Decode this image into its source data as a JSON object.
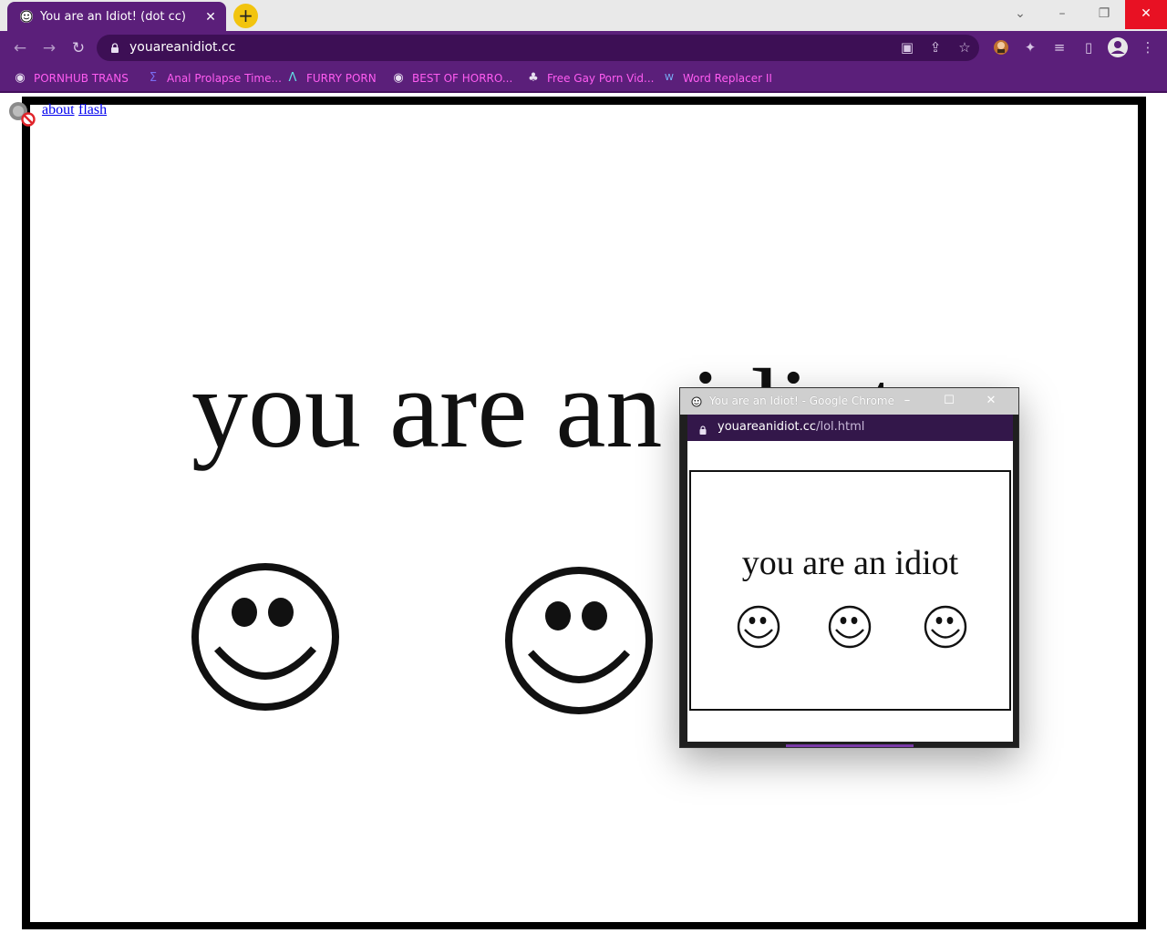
{
  "window": {
    "tab_title": "You are an Idiot! (dot cc)",
    "tab_close": "✕",
    "new_tab": "+",
    "controls": {
      "tabsearch": "⌄",
      "minimize": "–",
      "restore": "❐",
      "close": "✕"
    }
  },
  "toolbar": {
    "back": "←",
    "forward": "→",
    "reload": "↻",
    "url": "youareanidiot.cc",
    "icons": {
      "cast": "▣",
      "share": "⇪",
      "bookmark_star": "☆",
      "extensions": "✦",
      "media": "≡",
      "side_panel": "▯",
      "profile": "●",
      "menu": "⋮"
    }
  },
  "bookmarks": [
    {
      "label": "PORNHUB TRANS",
      "icon": "globe-icon",
      "glyph": "◉"
    },
    {
      "label": "Anal Prolapse Time...",
      "icon": "sigma-icon",
      "glyph": "Σ"
    },
    {
      "label": "FURRY PORN",
      "icon": "lambda-icon",
      "glyph": "Λ"
    },
    {
      "label": "BEST OF HORRO...",
      "icon": "globe-icon",
      "glyph": "◉"
    },
    {
      "label": "Free Gay Porn Vid...",
      "icon": "game-icon",
      "glyph": "♣"
    },
    {
      "label": "Word Replacer II",
      "icon": "wr-icon",
      "glyph": "W"
    }
  ],
  "page": {
    "links": {
      "about": "about",
      "flash": "flash"
    },
    "headline": "you are an idiot"
  },
  "popup": {
    "title": "You are an Idiot! - Google Chrome",
    "controls": {
      "minimize": "–",
      "maximize": "☐",
      "close": "✕"
    },
    "url_host": "youareanidiot.cc",
    "url_path": "/lol.html",
    "text": "you are an idiot"
  },
  "colors": {
    "chrome_purple": "#5b1f7a",
    "bookmark_text": "#ff5cf2",
    "close_red": "#e81123",
    "new_tab_yellow": "#f2c40f",
    "link_blue": "#0000ee"
  }
}
